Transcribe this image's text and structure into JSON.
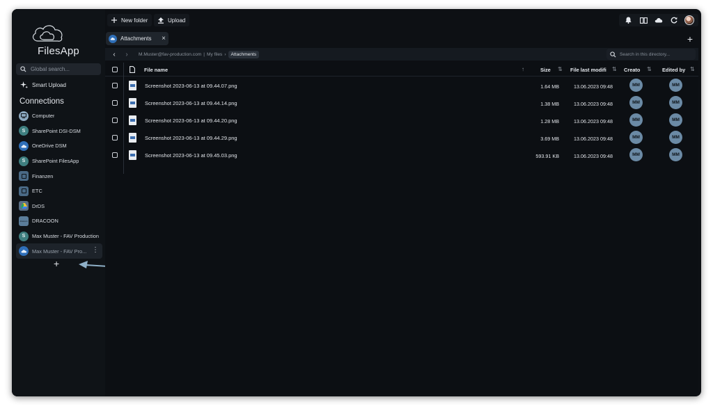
{
  "app": {
    "name": "FilesApp"
  },
  "sidebar": {
    "search_placeholder": "Global search...",
    "smart_upload": "Smart Upload",
    "connections_title": "Connections",
    "connections": [
      {
        "label": "Computer",
        "icon": "computer-icon"
      },
      {
        "label": "SharePoint DSI-DSM",
        "icon": "sharepoint-icon"
      },
      {
        "label": "OneDrive DSM",
        "icon": "onedrive-icon"
      },
      {
        "label": "SharePoint FilesApp",
        "icon": "sharepoint-icon"
      },
      {
        "label": "Finanzen",
        "icon": "folder-icon"
      },
      {
        "label": "ETC",
        "icon": "folder-icon"
      },
      {
        "label": "DrDS",
        "icon": "google-drive-icon"
      },
      {
        "label": "DRACOON",
        "icon": "dracoon-icon"
      },
      {
        "label": "Max Muster - FAV Production",
        "icon": "sharepoint-icon"
      },
      {
        "label": "Max Muster - FAV Pro...",
        "icon": "onedrive-icon",
        "active": true
      }
    ],
    "add_label": "+"
  },
  "toolbar": {
    "new_folder": "New folder",
    "upload": "Upload"
  },
  "tab": {
    "label": "Attachments",
    "close": "×",
    "add": "+"
  },
  "path": {
    "crumbs": [
      "M.Muster@fav-production.com",
      "My files"
    ],
    "separator": "|",
    "current": "Attachments",
    "search_placeholder": "Search in this directory..."
  },
  "table": {
    "columns": {
      "name": "File name",
      "size": "Size",
      "modified": "File last modifi",
      "created": "Creato",
      "edited": "Edited by"
    },
    "rows": [
      {
        "name": "Screenshot 2023-06-13 at 09.44.07.png",
        "size": "1.64 MB",
        "date": "13.06.2023 09:48",
        "creator": "MM",
        "editor": "MM"
      },
      {
        "name": "Screenshot 2023-06-13 at 09.44.14.png",
        "size": "1.38 MB",
        "date": "13.06.2023 09:48",
        "creator": "MM",
        "editor": "MM"
      },
      {
        "name": "Screenshot 2023-06-13 at 09.44.20.png",
        "size": "1.28 MB",
        "date": "13.06.2023 09:48",
        "creator": "MM",
        "editor": "MM"
      },
      {
        "name": "Screenshot 2023-06-13 at 09.44.29.png",
        "size": "3.69 MB",
        "date": "13.06.2023 09:48",
        "creator": "MM",
        "editor": "MM"
      },
      {
        "name": "Screenshot 2023-06-13 at 09.45.03.png",
        "size": "593.91 KB",
        "date": "13.06.2023 09:48",
        "creator": "MM",
        "editor": "MM"
      }
    ]
  },
  "colors": {
    "accent": "#6b8aa5",
    "bg": "#0d1014",
    "arrow": "#8fb0c8"
  }
}
